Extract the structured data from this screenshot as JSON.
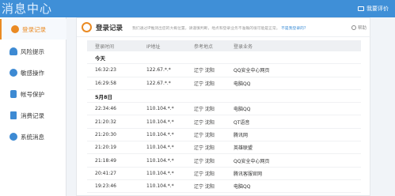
{
  "app": {
    "title": "消息中心",
    "feedback": "我要评价"
  },
  "sidebar": {
    "items": [
      {
        "label": "登录记录",
        "icon": "clock-icon",
        "active": true
      },
      {
        "label": "风险提示",
        "icon": "cloud-warning-icon",
        "active": false
      },
      {
        "label": "敏感操作",
        "icon": "face-icon",
        "active": false
      },
      {
        "label": "帐号保护",
        "icon": "lock-icon",
        "active": false
      },
      {
        "label": "消费记录",
        "icon": "document-icon",
        "active": false
      },
      {
        "label": "系统消息",
        "icon": "info-icon",
        "active": false
      }
    ]
  },
  "main": {
    "title": "登录记录",
    "desc": "我们通过IP推测出您的大概位置，请谨慎判断，地点和登录业务不准确的很可能是正常。",
    "desc_link": "不是我登录的?",
    "help": "帮助",
    "columns": [
      "登录时间",
      "IP地址",
      "参考地点",
      "登录业务"
    ],
    "groups": [
      {
        "label": "今天",
        "rows": [
          {
            "time": "16:32:23",
            "ip": "122.67.*.*",
            "place": "辽宁 沈阳",
            "service": "QQ安全中心网页"
          },
          {
            "time": "16:29:58",
            "ip": "122.67.*.*",
            "place": "辽宁 沈阳",
            "service": "电脑QQ"
          }
        ]
      },
      {
        "label": "5月8日",
        "rows": [
          {
            "time": "22:34:46",
            "ip": "110.104.*.*",
            "place": "辽宁 沈阳",
            "service": "电脑QQ"
          },
          {
            "time": "21:20:32",
            "ip": "110.104.*.*",
            "place": "辽宁 沈阳",
            "service": "QT语音"
          },
          {
            "time": "21:20:30",
            "ip": "110.104.*.*",
            "place": "辽宁 沈阳",
            "service": "腾讯网"
          },
          {
            "time": "21:20:19",
            "ip": "110.104.*.*",
            "place": "辽宁 沈阳",
            "service": "英雄联盟"
          },
          {
            "time": "21:18:49",
            "ip": "110.104.*.*",
            "place": "辽宁 沈阳",
            "service": "QQ安全中心网页"
          },
          {
            "time": "20:41:27",
            "ip": "110.104.*.*",
            "place": "辽宁 沈阳",
            "service": "腾讯客服官网"
          },
          {
            "time": "19:23:46",
            "ip": "110.104.*.*",
            "place": "辽宁 沈阳",
            "service": "电脑QQ"
          }
        ]
      }
    ]
  },
  "colors": {
    "accent": "#3f8fd7",
    "active": "#ea8a23"
  }
}
